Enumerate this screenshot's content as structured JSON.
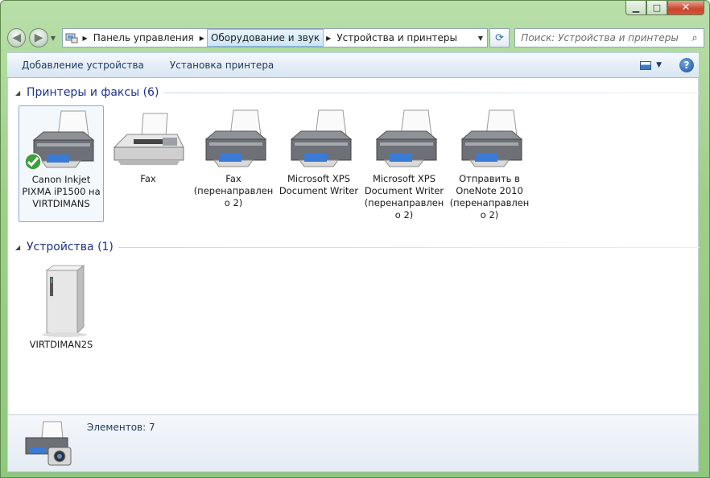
{
  "window": {
    "minimize_glyph": "▁",
    "maximize_glyph": "□",
    "close_glyph": "✕"
  },
  "navigation": {
    "back_glyph": "◀",
    "forward_glyph": "▶",
    "breadcrumb": [
      "Панель управления",
      "Оборудование и звук",
      "Устройства и принтеры"
    ],
    "search_placeholder": "Поиск: Устройства и принтеры"
  },
  "toolbar": {
    "add_device": "Добавление устройства",
    "add_printer": "Установка принтера",
    "help_glyph": "?"
  },
  "groups": [
    {
      "title": "Принтеры и факсы (6)",
      "items": [
        {
          "label": "Canon Inkjet PIXMA iP1500 на VIRTDIMANS",
          "icon": "printer-icon",
          "default": true
        },
        {
          "label": "Fax",
          "icon": "fax-icon"
        },
        {
          "label": "Fax (перенаправлен о 2)",
          "icon": "printer-icon"
        },
        {
          "label": "Microsoft XPS Document Writer",
          "icon": "printer-icon"
        },
        {
          "label": "Microsoft XPS Document Writer (перенаправлен о 2)",
          "icon": "printer-icon"
        },
        {
          "label": "Отправить в OneNote 2010 (перенаправлен о 2)",
          "icon": "printer-icon"
        }
      ]
    },
    {
      "title": "Устройства (1)",
      "items": [
        {
          "label": "VIRTDIMAN2S",
          "icon": "computer-tower-icon"
        }
      ]
    }
  ],
  "status": {
    "items_text": "Элементов: 7"
  },
  "colors": {
    "frame": "#9fd08a",
    "group_title": "#1e3287",
    "toolbar_text": "#1e395b"
  }
}
